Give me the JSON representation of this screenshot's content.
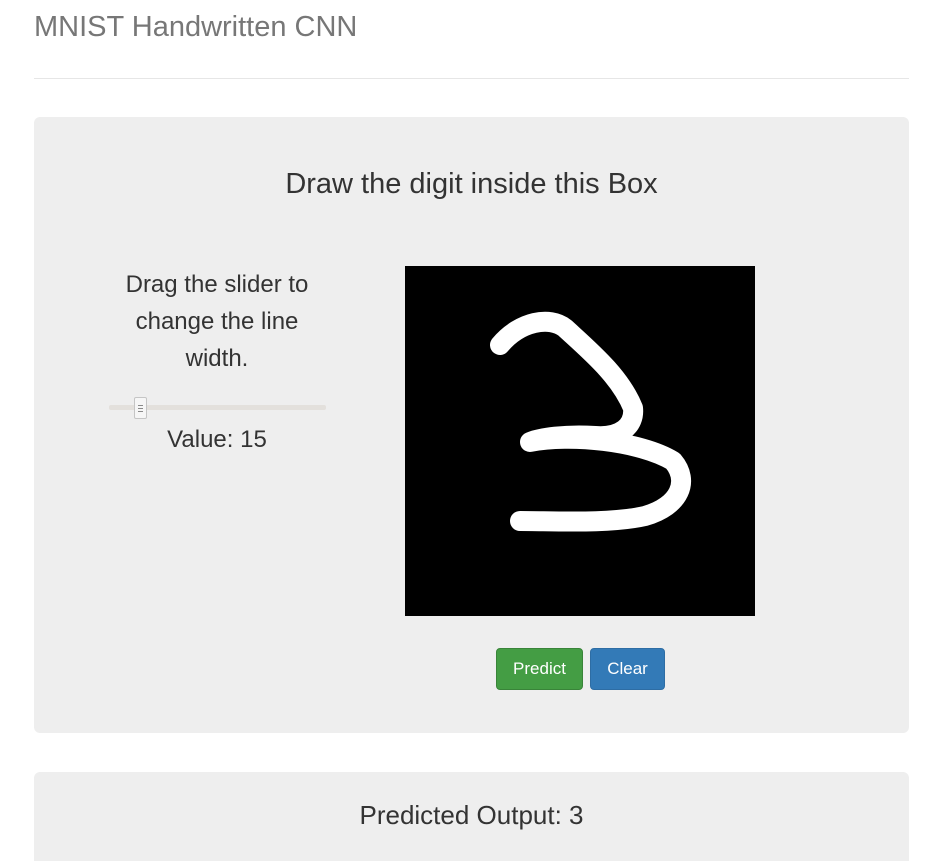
{
  "header": {
    "title": "MNIST Handwritten CNN"
  },
  "draw_panel": {
    "heading": "Draw the digit inside this Box",
    "canvas_background": "#000000",
    "stroke_color": "#ffffff",
    "drawn_digit": "3"
  },
  "slider": {
    "caption": "Drag the slider to change the line width.",
    "value_label": "Value: 15",
    "value": 15
  },
  "buttons": {
    "predict_label": "Predict",
    "predict_color": "#449d44",
    "clear_label": "Clear",
    "clear_color": "#337ab7"
  },
  "result": {
    "text": "Predicted Output: 3"
  }
}
